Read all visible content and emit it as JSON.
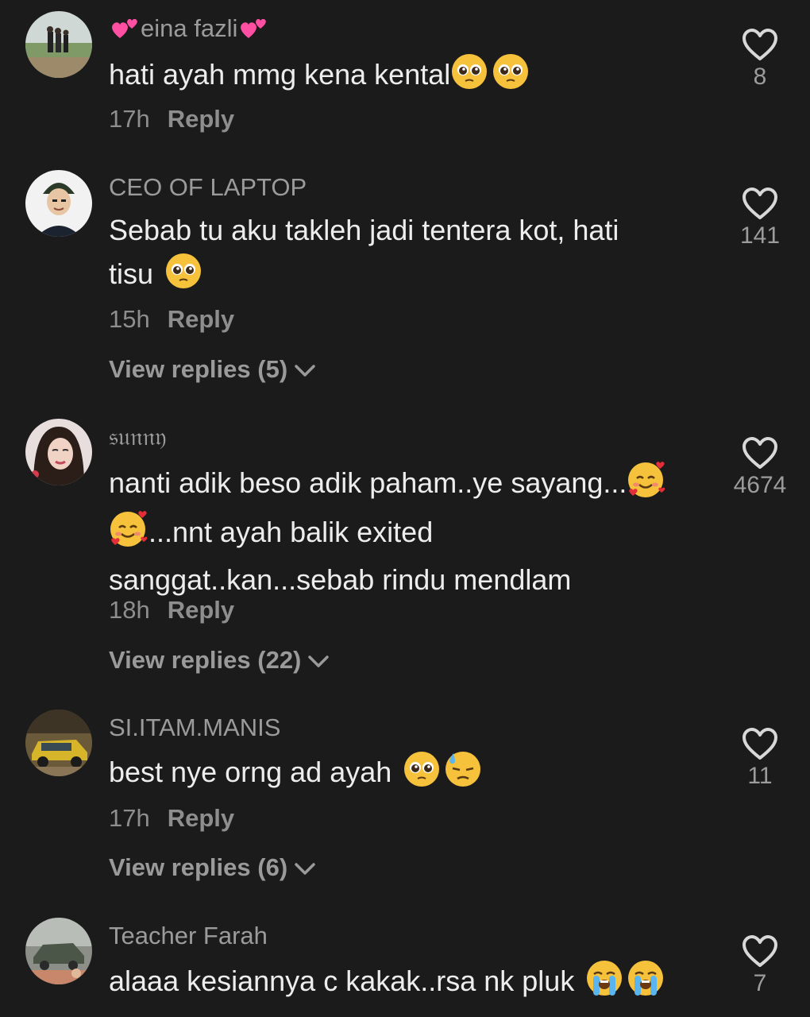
{
  "comments": [
    {
      "username": "eina fazli",
      "text": "hati ayah mmg kena kental",
      "time": "17h",
      "reply_label": "Reply",
      "likes": "8",
      "emojis": [
        "pleading-face",
        "pleading-face"
      ],
      "name_emojis": [
        "two-hearts",
        "two-hearts"
      ]
    },
    {
      "username": "CEO OF LAPTOP",
      "text_line1": "Sebab tu aku takleh jadi tentera kot, hati",
      "text_line2": "tisu",
      "time": "15h",
      "reply_label": "Reply",
      "likes": "141",
      "view_replies": "View replies (5)",
      "emojis": [
        "pleading-face"
      ]
    },
    {
      "username": "𝔰𝔲𝔫𝔫𝔶",
      "text_line1": "nanti adik beso adik paham..ye sayang...",
      "text_line2": "...nnt ayah balik exited",
      "text_line3": "sanggat..kan...sebab rindu mendlam",
      "time": "18h",
      "reply_label": "Reply",
      "likes": "4674",
      "view_replies": "View replies (22)",
      "emojis": [
        "smiling-face-with-hearts",
        "smiling-face-with-hearts"
      ]
    },
    {
      "username": "SI.ITAM.MANIS",
      "text": "best nye orng ad ayah",
      "time": "17h",
      "reply_label": "Reply",
      "likes": "11",
      "view_replies": "View replies (6)",
      "emojis": [
        "pleading-face",
        "downcast-face-with-sweat"
      ]
    },
    {
      "username": "Teacher Farah",
      "text": "alaaa kesiannya c kakak..rsa nk pluk",
      "likes": "7",
      "emojis": [
        "loudly-crying-face",
        "loudly-crying-face"
      ]
    }
  ],
  "colors": {
    "background": "#1b1b1b",
    "text": "#ededed",
    "muted": "#8e8e8e",
    "heart_outline": "#d8d8d8",
    "emoji_yellow": "#f7c23b"
  }
}
